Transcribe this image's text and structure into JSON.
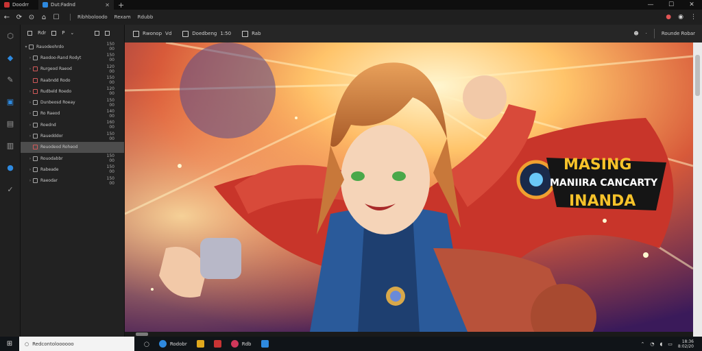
{
  "tabs": [
    {
      "label": "Doodrr",
      "color": "#c93434"
    },
    {
      "label": "Dut:Fadnd",
      "color": "#2e8ae0",
      "close": "✕"
    }
  ],
  "window_controls": [
    "—",
    "☐",
    "✕"
  ],
  "address": {
    "segments": [
      "Ribhboloodo",
      "Rexam",
      "Rdubb"
    ]
  },
  "rail": [
    {
      "icon": "polygon-icon"
    },
    {
      "icon": "drop-icon",
      "blue": true
    },
    {
      "icon": "pin-icon"
    },
    {
      "icon": "layer-icon",
      "blue": true
    },
    {
      "icon": "image-icon"
    },
    {
      "icon": "save-icon"
    },
    {
      "icon": "globe-icon",
      "blue": true
    },
    {
      "icon": "check-icon"
    }
  ],
  "explorer": {
    "toolbar": [
      "Rdr",
      "P"
    ],
    "rows": [
      {
        "label": "Rauodeohrdo",
        "value": "150 00",
        "caret": "▾",
        "icon": "plain"
      },
      {
        "label": "Raodoo-Rand Rodyt",
        "value": "150 00",
        "caret": "›",
        "icon": "folder"
      },
      {
        "label": "Rurgeod Raeod",
        "value": "120 00",
        "caret": "›",
        "icon": "red"
      },
      {
        "label": "Raabndd Rodo",
        "value": "150 00",
        "caret": "",
        "icon": "red"
      },
      {
        "label": "Rudbeld Roedo",
        "value": "120 00",
        "caret": "›",
        "icon": "red"
      },
      {
        "label": "Dunbeosd Roeay",
        "value": "150 00",
        "caret": "›",
        "icon": "plain"
      },
      {
        "label": "Ro Raeod",
        "value": "140 00",
        "caret": "›",
        "icon": "plain"
      },
      {
        "label": "Roednd",
        "value": "160 00",
        "caret": "›",
        "icon": "plain"
      },
      {
        "label": "Rauedddor",
        "value": "150 00",
        "caret": "›",
        "icon": "plain"
      },
      {
        "label": "Reuodeod Roheod",
        "value": "",
        "caret": "",
        "icon": "red",
        "selected": true
      },
      {
        "label": "Rouodabbr",
        "value": "150 00",
        "caret": "›",
        "icon": "plain"
      },
      {
        "label": "Rabeade",
        "value": "150 00",
        "caret": "›",
        "icon": "plain"
      },
      {
        "label": "Raeodar",
        "value": "150 00",
        "caret": "›",
        "icon": "plain"
      }
    ]
  },
  "editor_toolbar": {
    "items": [
      {
        "label": "Rwonop",
        "extra": "Vd"
      },
      {
        "label": "Doedbeng",
        "extra": "1:50"
      },
      {
        "label": "Rab",
        "extra": ""
      }
    ],
    "right_label": "Rounde Robar"
  },
  "canvas": {
    "logo_line1": "MASING",
    "logo_line2": "MANIIRA CANCARTY",
    "logo_line3": "INANDA"
  },
  "taskbar": {
    "search_placeholder": "Redcontoloooooo",
    "apps": [
      {
        "label": "Rodobr",
        "color": "#2e8ae0"
      },
      {
        "label": "",
        "color": "#e0a81c"
      },
      {
        "label": "",
        "color": "#c93434"
      },
      {
        "label": "Rdb",
        "color": "#d0375a"
      },
      {
        "label": "",
        "color": "#2e8ae0"
      }
    ],
    "clock_time": "18:36",
    "clock_date": "8:02/20"
  }
}
